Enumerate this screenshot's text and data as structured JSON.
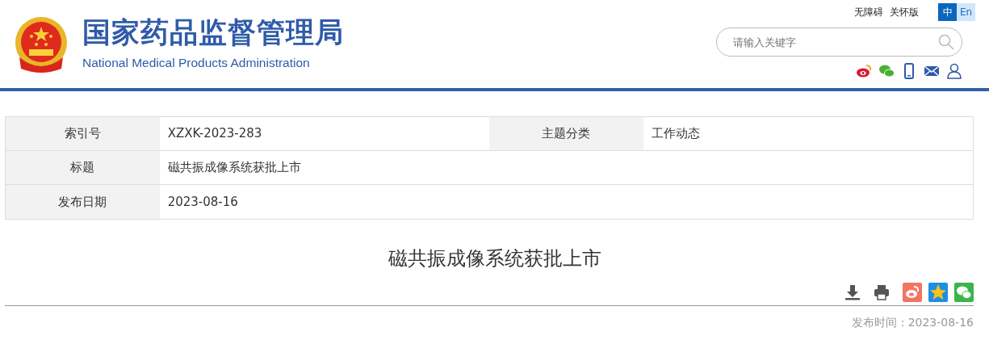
{
  "header": {
    "title_cn": "国家药品监督管理局",
    "title_en": "National Medical Products Administration",
    "links": [
      "无障碍",
      "关怀版"
    ],
    "languages": [
      {
        "label": "中",
        "selected": true
      },
      {
        "label": "En",
        "selected": false
      }
    ],
    "search": {
      "placeholder": "请输入关键字"
    },
    "social": [
      {
        "kind": "weibo"
      },
      {
        "kind": "wechat"
      },
      {
        "kind": "phone"
      },
      {
        "kind": "mail"
      },
      {
        "kind": "user"
      }
    ]
  },
  "info_table": {
    "rows": [
      {
        "cells": [
          {
            "label": "索引号",
            "value": "XZXK-2023-283"
          },
          {
            "label": "主题分类",
            "value": "工作动态"
          }
        ]
      },
      {
        "cells": [
          {
            "label": "标题",
            "value": "磁共振成像系统获批上市"
          }
        ]
      },
      {
        "cells": [
          {
            "label": "发布日期",
            "value": "2023-08-16"
          }
        ]
      }
    ]
  },
  "article": {
    "title": "磁共振成像系统获批上市",
    "tools": [
      {
        "kind": "download"
      },
      {
        "kind": "print"
      },
      {
        "kind": "weibo-share"
      },
      {
        "kind": "qzone-share"
      },
      {
        "kind": "wechat-share"
      }
    ],
    "date_label": "发布时间：",
    "date": "2023-08-16"
  }
}
